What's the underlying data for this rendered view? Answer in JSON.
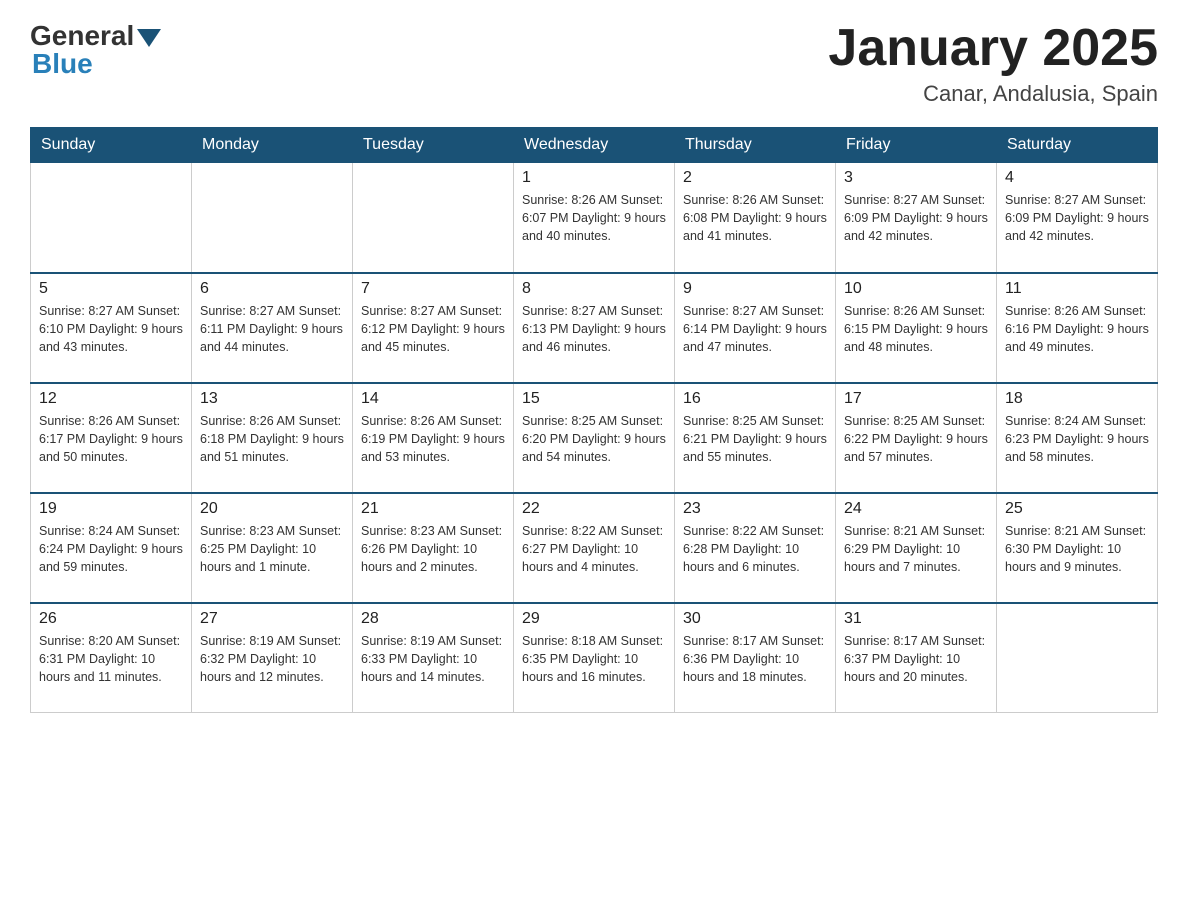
{
  "header": {
    "logo_general": "General",
    "logo_blue": "Blue",
    "month_title": "January 2025",
    "location": "Canar, Andalusia, Spain"
  },
  "days_of_week": [
    "Sunday",
    "Monday",
    "Tuesday",
    "Wednesday",
    "Thursday",
    "Friday",
    "Saturday"
  ],
  "weeks": [
    [
      {
        "day": "",
        "info": ""
      },
      {
        "day": "",
        "info": ""
      },
      {
        "day": "",
        "info": ""
      },
      {
        "day": "1",
        "info": "Sunrise: 8:26 AM\nSunset: 6:07 PM\nDaylight: 9 hours\nand 40 minutes."
      },
      {
        "day": "2",
        "info": "Sunrise: 8:26 AM\nSunset: 6:08 PM\nDaylight: 9 hours\nand 41 minutes."
      },
      {
        "day": "3",
        "info": "Sunrise: 8:27 AM\nSunset: 6:09 PM\nDaylight: 9 hours\nand 42 minutes."
      },
      {
        "day": "4",
        "info": "Sunrise: 8:27 AM\nSunset: 6:09 PM\nDaylight: 9 hours\nand 42 minutes."
      }
    ],
    [
      {
        "day": "5",
        "info": "Sunrise: 8:27 AM\nSunset: 6:10 PM\nDaylight: 9 hours\nand 43 minutes."
      },
      {
        "day": "6",
        "info": "Sunrise: 8:27 AM\nSunset: 6:11 PM\nDaylight: 9 hours\nand 44 minutes."
      },
      {
        "day": "7",
        "info": "Sunrise: 8:27 AM\nSunset: 6:12 PM\nDaylight: 9 hours\nand 45 minutes."
      },
      {
        "day": "8",
        "info": "Sunrise: 8:27 AM\nSunset: 6:13 PM\nDaylight: 9 hours\nand 46 minutes."
      },
      {
        "day": "9",
        "info": "Sunrise: 8:27 AM\nSunset: 6:14 PM\nDaylight: 9 hours\nand 47 minutes."
      },
      {
        "day": "10",
        "info": "Sunrise: 8:26 AM\nSunset: 6:15 PM\nDaylight: 9 hours\nand 48 minutes."
      },
      {
        "day": "11",
        "info": "Sunrise: 8:26 AM\nSunset: 6:16 PM\nDaylight: 9 hours\nand 49 minutes."
      }
    ],
    [
      {
        "day": "12",
        "info": "Sunrise: 8:26 AM\nSunset: 6:17 PM\nDaylight: 9 hours\nand 50 minutes."
      },
      {
        "day": "13",
        "info": "Sunrise: 8:26 AM\nSunset: 6:18 PM\nDaylight: 9 hours\nand 51 minutes."
      },
      {
        "day": "14",
        "info": "Sunrise: 8:26 AM\nSunset: 6:19 PM\nDaylight: 9 hours\nand 53 minutes."
      },
      {
        "day": "15",
        "info": "Sunrise: 8:25 AM\nSunset: 6:20 PM\nDaylight: 9 hours\nand 54 minutes."
      },
      {
        "day": "16",
        "info": "Sunrise: 8:25 AM\nSunset: 6:21 PM\nDaylight: 9 hours\nand 55 minutes."
      },
      {
        "day": "17",
        "info": "Sunrise: 8:25 AM\nSunset: 6:22 PM\nDaylight: 9 hours\nand 57 minutes."
      },
      {
        "day": "18",
        "info": "Sunrise: 8:24 AM\nSunset: 6:23 PM\nDaylight: 9 hours\nand 58 minutes."
      }
    ],
    [
      {
        "day": "19",
        "info": "Sunrise: 8:24 AM\nSunset: 6:24 PM\nDaylight: 9 hours\nand 59 minutes."
      },
      {
        "day": "20",
        "info": "Sunrise: 8:23 AM\nSunset: 6:25 PM\nDaylight: 10 hours\nand 1 minute."
      },
      {
        "day": "21",
        "info": "Sunrise: 8:23 AM\nSunset: 6:26 PM\nDaylight: 10 hours\nand 2 minutes."
      },
      {
        "day": "22",
        "info": "Sunrise: 8:22 AM\nSunset: 6:27 PM\nDaylight: 10 hours\nand 4 minutes."
      },
      {
        "day": "23",
        "info": "Sunrise: 8:22 AM\nSunset: 6:28 PM\nDaylight: 10 hours\nand 6 minutes."
      },
      {
        "day": "24",
        "info": "Sunrise: 8:21 AM\nSunset: 6:29 PM\nDaylight: 10 hours\nand 7 minutes."
      },
      {
        "day": "25",
        "info": "Sunrise: 8:21 AM\nSunset: 6:30 PM\nDaylight: 10 hours\nand 9 minutes."
      }
    ],
    [
      {
        "day": "26",
        "info": "Sunrise: 8:20 AM\nSunset: 6:31 PM\nDaylight: 10 hours\nand 11 minutes."
      },
      {
        "day": "27",
        "info": "Sunrise: 8:19 AM\nSunset: 6:32 PM\nDaylight: 10 hours\nand 12 minutes."
      },
      {
        "day": "28",
        "info": "Sunrise: 8:19 AM\nSunset: 6:33 PM\nDaylight: 10 hours\nand 14 minutes."
      },
      {
        "day": "29",
        "info": "Sunrise: 8:18 AM\nSunset: 6:35 PM\nDaylight: 10 hours\nand 16 minutes."
      },
      {
        "day": "30",
        "info": "Sunrise: 8:17 AM\nSunset: 6:36 PM\nDaylight: 10 hours\nand 18 minutes."
      },
      {
        "day": "31",
        "info": "Sunrise: 8:17 AM\nSunset: 6:37 PM\nDaylight: 10 hours\nand 20 minutes."
      },
      {
        "day": "",
        "info": ""
      }
    ]
  ]
}
